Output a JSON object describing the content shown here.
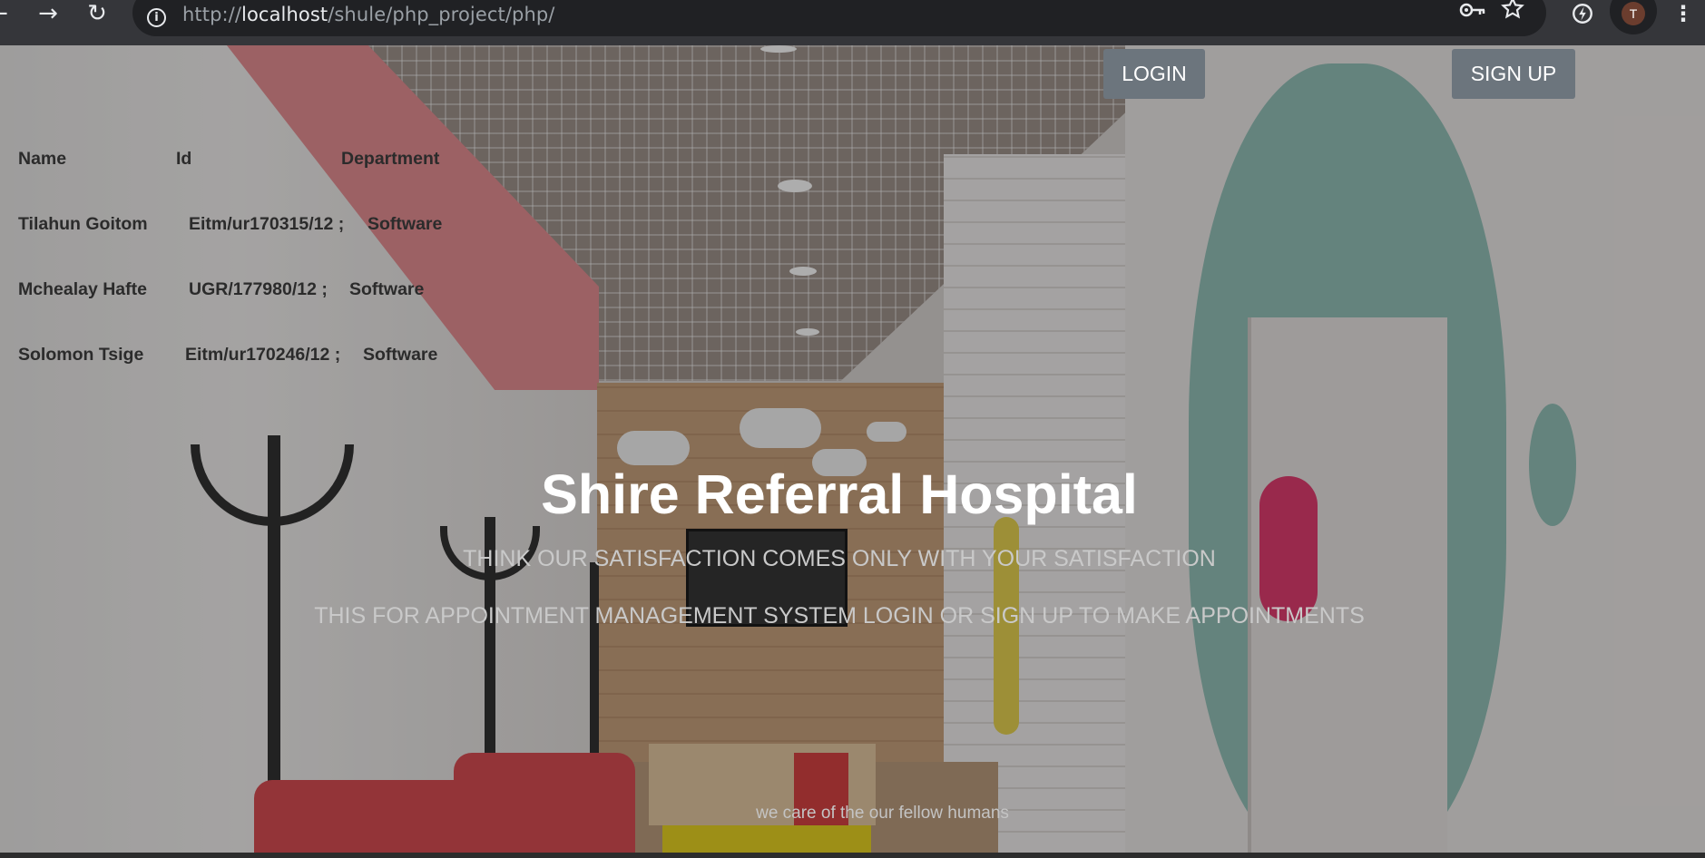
{
  "browser": {
    "url_scheme": "http://",
    "url_host": "localhost",
    "url_path": "/shule/php_project/php/",
    "avatar_letter": "T",
    "icons": {
      "back": "arrow-left-icon",
      "forward": "arrow-right-icon",
      "reload": "reload-icon",
      "site_info": "info-icon",
      "password": "key-icon",
      "bookmark": "star-icon",
      "extension": "extension-icon",
      "menu": "kebab-menu-icon"
    }
  },
  "page": {
    "team": {
      "headers": {
        "name": "Name",
        "id": "Id",
        "department": "Department"
      },
      "members": [
        {
          "name": "Tilahun Goitom",
          "id": "Eitm/ur170315/12 ;",
          "department": "Software"
        },
        {
          "name": "Mchealay Hafte",
          "id": "UGR/177980/12 ;",
          "department": "Software"
        },
        {
          "name": "Solomon Tsige",
          "id": "Eitm/ur170246/12 ;",
          "department": "Software"
        }
      ]
    },
    "nav": {
      "login": "LOGIN",
      "signup": "SIGN UP"
    },
    "hero": {
      "title": "Shire Referral Hospital",
      "tagline": "THINK OUR SATISFACTION COMES ONLY WITH YOUR SATISFACTION",
      "subtext": "THIS FOR APPOINTMENT MANAGEMENT SYSTEM LOGIN OR SIGN UP TO MAKE APPOINTMENTS"
    },
    "footer": "we care of the our fellow humans",
    "colors": {
      "button_bg": "#6c757d",
      "title": "#ffffff",
      "subtitle": "#c9c9c9"
    }
  }
}
